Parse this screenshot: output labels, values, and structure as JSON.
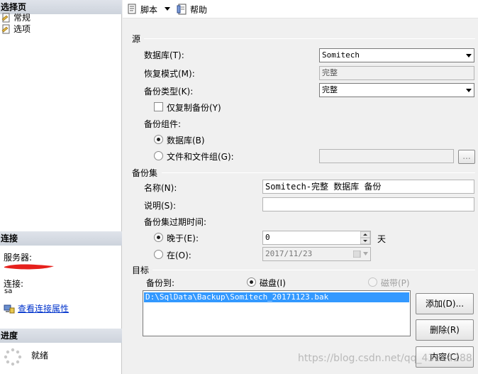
{
  "left": {
    "select_page_header": "选择页",
    "pages": [
      "常规",
      "选项"
    ],
    "connection_header": "连接",
    "server_label": "服务器:",
    "connection_label": "连接:",
    "connection_user": "sa",
    "view_connection_link": "查看连接属性",
    "progress_header": "进度",
    "status_text": "就绪"
  },
  "toolbar": {
    "script_label": "脚本",
    "help_label": "帮助"
  },
  "source": {
    "group_title": "源",
    "database_label": "数据库(T):",
    "database_value": "Somitech",
    "recovery_label": "恢复模式(M):",
    "recovery_value": "完整",
    "backup_type_label": "备份类型(K):",
    "backup_type_value": "完整",
    "copy_only_label": "仅复制备份(Y)",
    "components_label": "备份组件:",
    "component_database_label": "数据库(B)",
    "component_files_label": "文件和文件组(G):",
    "files_browse_label": "..."
  },
  "backup_set": {
    "group_title": "备份集",
    "name_label": "名称(N):",
    "name_value": "Somitech-完整 数据库 备份",
    "description_label": "说明(S):",
    "description_value": "",
    "expire_label": "备份集过期时间:",
    "after_label": "晚于(E):",
    "after_value": "0",
    "days_unit": "天",
    "on_label": "在(O):",
    "on_value": "2017/11/23"
  },
  "destination": {
    "group_title": "目标",
    "backup_to_label": "备份到:",
    "disk_label": "磁盘(I)",
    "tape_label": "磁带(P)",
    "paths": [
      "D:\\SqlData\\Backup\\Somitech_20171123.bak"
    ],
    "add_label": "添加(D)...",
    "remove_label": "删除(R)",
    "contents_label": "内容(C)"
  },
  "watermark": "https://blog.csdn.net/qq_43614288"
}
